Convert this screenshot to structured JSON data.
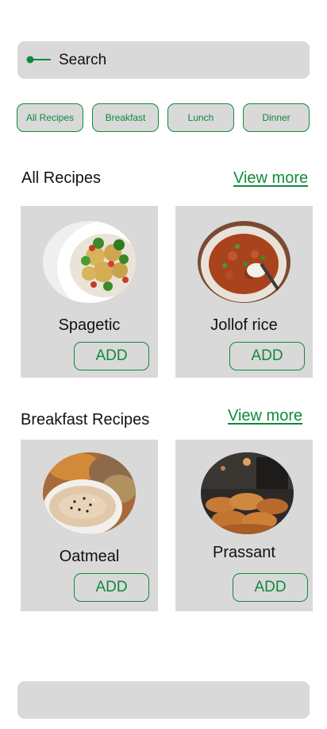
{
  "search": {
    "label": "Search",
    "icon": "search-icon"
  },
  "filters": [
    "All Recipes",
    "Breakfast",
    "Lunch",
    "Dinner"
  ],
  "sections": [
    {
      "title": "All Recipes",
      "view_more": "View more",
      "recipes": [
        {
          "name": "Spagetic",
          "add_label": "ADD",
          "image": "pasta-salad-photo"
        },
        {
          "name": "Jollof rice",
          "add_label": "ADD",
          "image": "stew-bowl-photo"
        }
      ]
    },
    {
      "title": "Breakfast Recipes",
      "view_more": "View more",
      "recipes": [
        {
          "name": "Oatmeal",
          "add_label": "ADD",
          "image": "oatmeal-bowl-photo"
        },
        {
          "name": "Prassant",
          "add_label": "ADD",
          "image": "croissants-photo"
        }
      ]
    }
  ],
  "colors": {
    "accent": "#0f8a3a",
    "surface": "#d9d9d9",
    "background": "#ffffff"
  }
}
